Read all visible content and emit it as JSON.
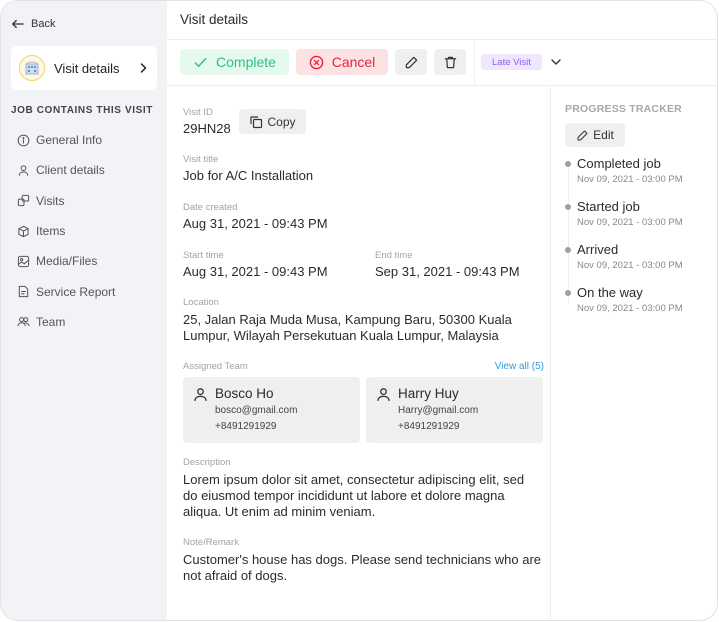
{
  "sidebar": {
    "back_label": "Back",
    "current_card": {
      "label": "Visit details",
      "icon": "building-avatar"
    },
    "section_title": "JOB CONTAINS THIS VISIT",
    "items": [
      {
        "label": "General Info",
        "icon": "info-icon"
      },
      {
        "label": "Client details",
        "icon": "user-icon"
      },
      {
        "label": "Visits",
        "icon": "visits-icon"
      },
      {
        "label": "Items",
        "icon": "box-icon"
      },
      {
        "label": "Media/Files",
        "icon": "image-icon"
      },
      {
        "label": "Service Report",
        "icon": "report-icon"
      },
      {
        "label": "Team",
        "icon": "team-icon"
      }
    ]
  },
  "header": {
    "title": "Visit details"
  },
  "toolbar": {
    "complete_label": "Complete",
    "cancel_label": "Cancel",
    "status_badge": "Late Visit",
    "colors": {
      "complete": "#2fbf82",
      "cancel": "#e5263d",
      "badge": "#8a5cf0"
    }
  },
  "details": {
    "visit_id_label": "Visit ID",
    "visit_id": "29HN28",
    "copy_label": "Copy",
    "visit_title_label": "Visit title",
    "visit_title": "Job for A/C Installation",
    "date_created_label": "Date created",
    "date_created": "Aug 31, 2021 - 09:43 PM",
    "start_time_label": "Start time",
    "start_time": "Aug 31, 2021 - 09:43 PM",
    "end_time_label": "End time",
    "end_time": "Sep 31, 2021 - 09:43 PM",
    "location_label": "Location",
    "location_line1": "25, Jalan Raja Muda Musa, Kampung Baru, 50300 Kuala",
    "location_line2": "Lumpur, Wilayah Persekutuan Kuala Lumpur, Malaysia",
    "assigned_team_label": "Assigned Team",
    "view_all_label": "View all (5)",
    "team": [
      {
        "name": "Bosco Ho",
        "email": "bosco@gmail.com",
        "phone": "+8491291929"
      },
      {
        "name": "Harry Huy",
        "email": "Harry@gmail.com",
        "phone": "+8491291929"
      }
    ],
    "description_label": "Description",
    "description_lines": [
      "Lorem ipsum dolor sit amet, consectetur adipiscing elit, sed",
      "do eiusmod tempor incididunt ut labore et dolore magna",
      "aliqua. Ut enim ad minim veniam."
    ],
    "note_label": "Note/Remark",
    "note_lines": [
      "Customer's house has dogs. Please send technicians who are",
      "not afraid of dogs."
    ]
  },
  "progress": {
    "title": "PROGRESS TRACKER",
    "edit_label": "Edit",
    "steps": [
      {
        "name": "Completed job",
        "time": "Nov 09, 2021 - 03:00 PM"
      },
      {
        "name": "Started job",
        "time": "Nov 09, 2021 - 03:00 PM"
      },
      {
        "name": "Arrived",
        "time": "Nov 09, 2021 - 03:00 PM"
      },
      {
        "name": "On the way",
        "time": "Nov 09, 2021 - 03:00 PM"
      }
    ]
  }
}
